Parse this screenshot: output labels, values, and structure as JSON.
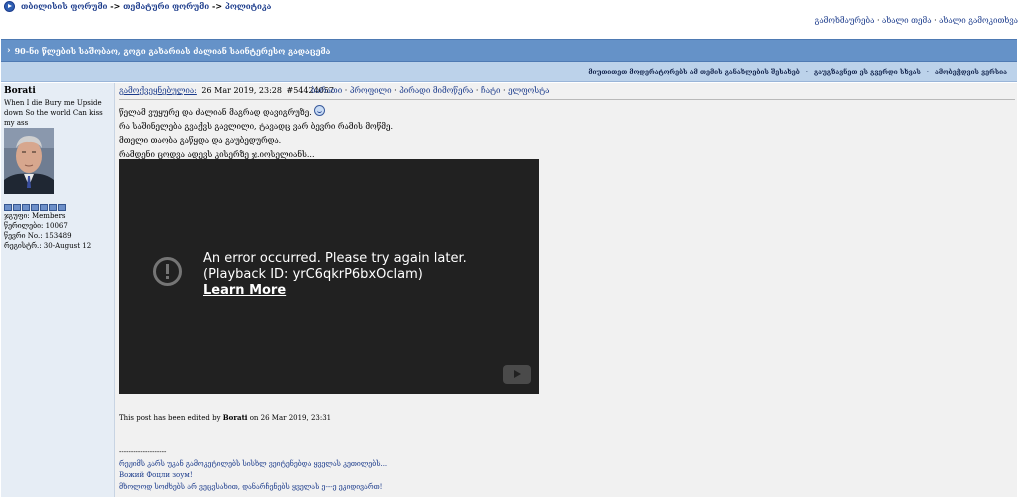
{
  "nav": {
    "crumbs": [
      "თბილისის ფორუმი",
      "->",
      "თემატური ფორუმი",
      "->",
      "პოლიტიკა"
    ],
    "top_links": [
      "გამოხმაურება",
      "ახალი თემა",
      "ახალი გამოკითხვა"
    ],
    "top_sep": "·"
  },
  "topic": {
    "arrow": "›",
    "title": "90-ნი წლების საშობაო, გოგი გახარიას ძალიან საინტერესო გადაცემა"
  },
  "subbar": {
    "links": [
      "მიუთითეთ მოდერატორებს ამ თემის განახლების შესახებ",
      "გაუგზავნეთ ეს გვერდი სხვას",
      "ამობეჭდვის ვერსია"
    ],
    "sep": "·"
  },
  "author": {
    "name": "Borati",
    "tagline": "When I die Bury me Upside down So the world Can kiss my ass",
    "group": "ჯგუფი: Members",
    "posts": "წერილები: 10067",
    "member_no": "წევრი No.: 153489",
    "registered": "რეგისტრ.: 30-August 12"
  },
  "post": {
    "posted_label": "გამოქვეყნებულია:",
    "date": "26 Mar 2019, 23:28",
    "id": "#54424057",
    "links": [
      "ბარათი",
      "პროფილი",
      "პირადი მიმოწერა",
      "ჩატი",
      "ელფოსტა"
    ],
    "link_sep": "·",
    "lines": [
      "წელამ ვუყურე და ძალიან მაგრად დავიგრუზე.",
      "რა საშინელება გვაქვს გავლილი, ტავადც ვარ ბევრი რამის მოწმე.",
      "მთელი თაობა გაწყდა და გაუბედურდა.",
      "რამდენი ცოდვა ადევს კისერზე ჯ.იოსელიანს..."
    ],
    "video": {
      "line1": "An error occurred. Please try again later.",
      "line2": "(Playback ID: yrC6qkrP6bxOclam)",
      "learn_more": "Learn More"
    },
    "edited_prefix": "This post has been edited by",
    "edited_by": "Borati",
    "edited_suffix": "on 26 Mar 2019, 23:31",
    "signature": [
      "--------------------",
      "რეჟიმს კარს უკან გამოკეტილებს სისხლ ვეიტენებდა ყველას კეთილებს...",
      "Вожий Фоцли зоум!",
      "მხოლოდ სოძხებს არ ვეცვსახით, დანარჩენებს ყველას ე---ე ეკიდივართ!"
    ]
  }
}
